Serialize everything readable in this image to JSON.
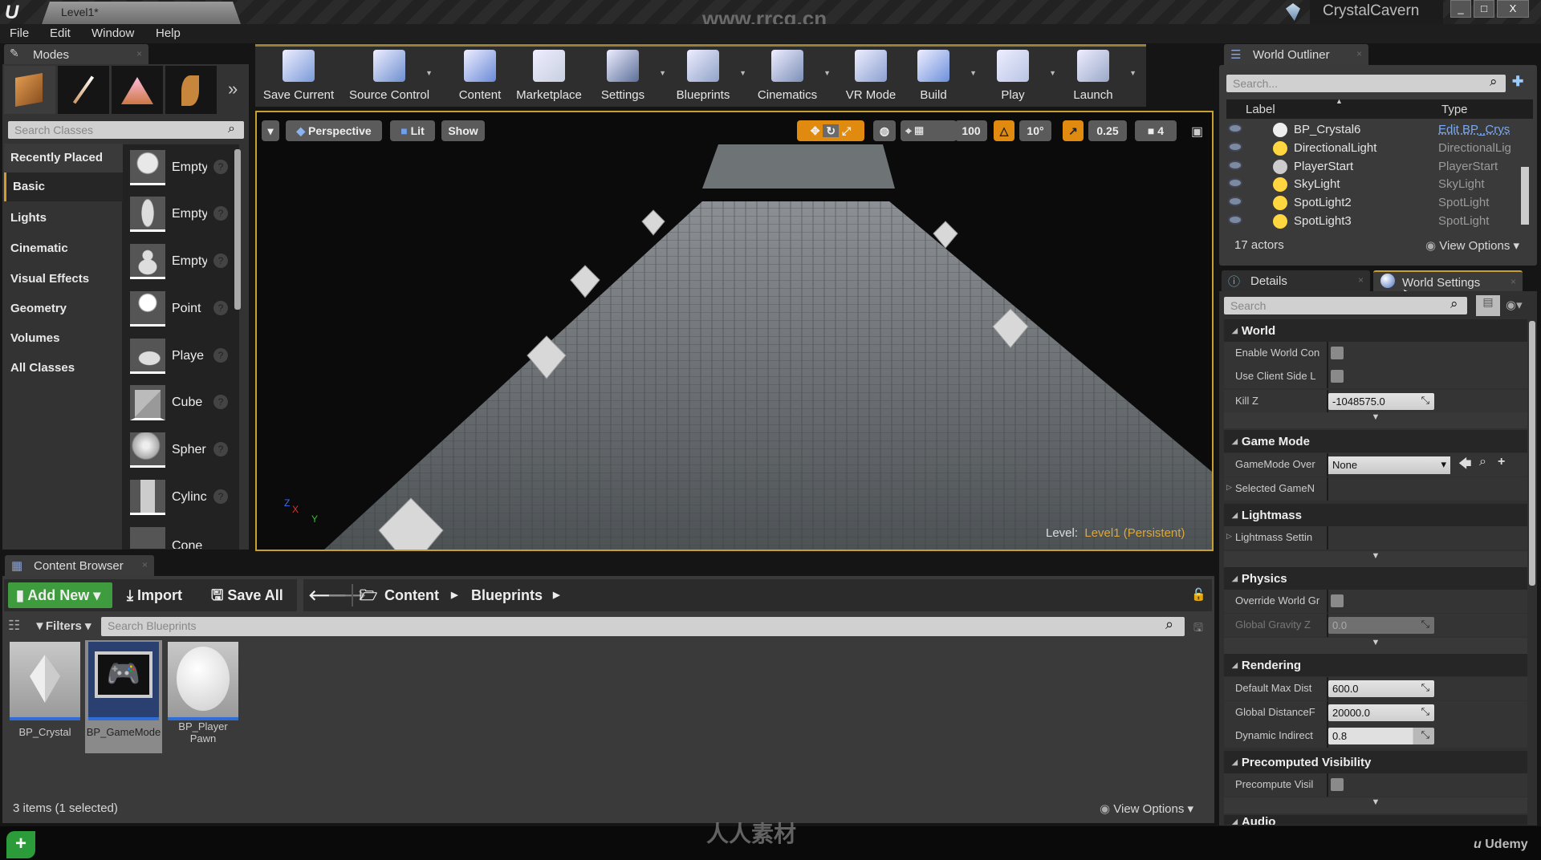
{
  "titlebar": {
    "logo": "unreal-logo",
    "document_tab": "Level1*",
    "watermark": "www.rrcg.cn",
    "project_name": "CrystalCavern",
    "window_buttons": [
      "_",
      "□",
      "X"
    ]
  },
  "menu": [
    "File",
    "Edit",
    "Window",
    "Help"
  ],
  "modes": {
    "tab_label": "Modes",
    "mode_icons": [
      "place-mode-icon",
      "paint-mode-icon",
      "landscape-mode-icon",
      "foliage-mode-icon"
    ],
    "more": "»",
    "search_placeholder": "Search Classes",
    "categories": [
      "Recently Placed",
      "Basic",
      "Lights",
      "Cinematic",
      "Visual Effects",
      "Geometry",
      "Volumes",
      "All Classes"
    ],
    "selected_category": "Basic",
    "items": [
      "Empty",
      "Empty",
      "Empty",
      "Point",
      "Playe",
      "Cube",
      "Spher",
      "Cylinc",
      "Cone"
    ],
    "help": "?"
  },
  "toolbar": [
    {
      "label": "Save Current",
      "icon": "save-icon",
      "color": "#7a9ad8",
      "dropdown": false
    },
    {
      "label": "Source Control",
      "icon": "source-control-icon",
      "color": "#6d8fd0",
      "dropdown": true
    },
    {
      "label": "Content",
      "icon": "content-icon",
      "color": "#6a8ad8",
      "dropdown": false
    },
    {
      "label": "Marketplace",
      "icon": "marketplace-icon",
      "color": "#c8cfe0",
      "dropdown": false
    },
    {
      "label": "Settings",
      "icon": "settings-icon",
      "color": "#5b6f99",
      "dropdown": true
    },
    {
      "label": "Blueprints",
      "icon": "blueprints-icon",
      "color": "#8fa2c8",
      "dropdown": true
    },
    {
      "label": "Cinematics",
      "icon": "cinematics-icon",
      "color": "#7c8fb8",
      "dropdown": true
    },
    {
      "label": "VR Mode",
      "icon": "vr-mode-icon",
      "color": "#8aa0d0",
      "dropdown": false
    },
    {
      "label": "Build",
      "icon": "build-icon",
      "color": "#6d90dc",
      "dropdown": true
    },
    {
      "label": "Play",
      "icon": "play-icon",
      "color": "#b8c4e4",
      "dropdown": true
    },
    {
      "label": "Launch",
      "icon": "launch-icon",
      "color": "#9aa8c8",
      "dropdown": true
    }
  ],
  "viewport": {
    "perspective": "Perspective",
    "lit": "Lit",
    "show": "Show",
    "grid_snap": "100",
    "rotation_snap": "10°",
    "scale_snap": "0.25",
    "camera_speed": "4",
    "level_label": "Level:",
    "level_name": "Level1 (Persistent)",
    "accent": "#e08a10",
    "axes": [
      "X",
      "Y",
      "Z"
    ]
  },
  "outliner": {
    "tab_label": "World Outliner",
    "search_placeholder": "Search...",
    "columns": [
      "Label",
      "Type"
    ],
    "rows": [
      {
        "label": "BP_Crystal6",
        "type": "Edit BP_Crys",
        "link": true
      },
      {
        "label": "DirectionalLight",
        "type": "DirectionalLig"
      },
      {
        "label": "PlayerStart",
        "type": "PlayerStart"
      },
      {
        "label": "SkyLight",
        "type": "SkyLight"
      },
      {
        "label": "SpotLight2",
        "type": "SpotLight"
      },
      {
        "label": "SpotLight3",
        "type": "SpotLight"
      }
    ],
    "count": "17 actors",
    "view_options": "View Options"
  },
  "details": {
    "tabs": [
      "Details",
      "World Settings"
    ],
    "active_tab": "World Settings",
    "search_placeholder": "Search",
    "sections": {
      "world": {
        "title": "World",
        "enable_world": "Enable World Con",
        "use_client": "Use Client Side L",
        "kill_z_label": "Kill Z",
        "kill_z": "-1048575.0"
      },
      "game_mode": {
        "title": "Game Mode",
        "override_label": "GameMode Over",
        "override_value": "None",
        "selected": "Selected GameN"
      },
      "lightmass": {
        "title": "Lightmass",
        "settings": "Lightmass Settin"
      },
      "physics": {
        "title": "Physics",
        "override_gravity": "Override World Gr",
        "gravity_label": "Global Gravity Z",
        "gravity": "0.0"
      },
      "rendering": {
        "title": "Rendering",
        "max_dist_label": "Default Max Dist",
        "max_dist": "600.0",
        "global_df_label": "Global DistanceF",
        "global_df": "20000.0",
        "dyn_label": "Dynamic Indirect",
        "dyn": "0.8"
      },
      "precomputed": {
        "title": "Precomputed Visibility",
        "precompute": "Precompute Visil"
      },
      "audio": {
        "title": "Audio"
      }
    }
  },
  "content_browser": {
    "tab_label": "Content Browser",
    "add_new": "Add New",
    "import": "Import",
    "save_all": "Save All",
    "path": [
      "Content",
      "Blueprints"
    ],
    "filters": "Filters",
    "search_placeholder": "Search Blueprints",
    "assets": [
      {
        "name": "BP_Crystal",
        "selected": false
      },
      {
        "name": "BP_GameMode",
        "selected": true
      },
      {
        "name": "BP_Player Pawn",
        "selected": false
      }
    ],
    "status": "3 items (1 selected)",
    "view_options": "View Options",
    "add_color": "#3e9b3e"
  },
  "bottom": {
    "watermark": "人人素材",
    "udemy": "Udemy"
  }
}
